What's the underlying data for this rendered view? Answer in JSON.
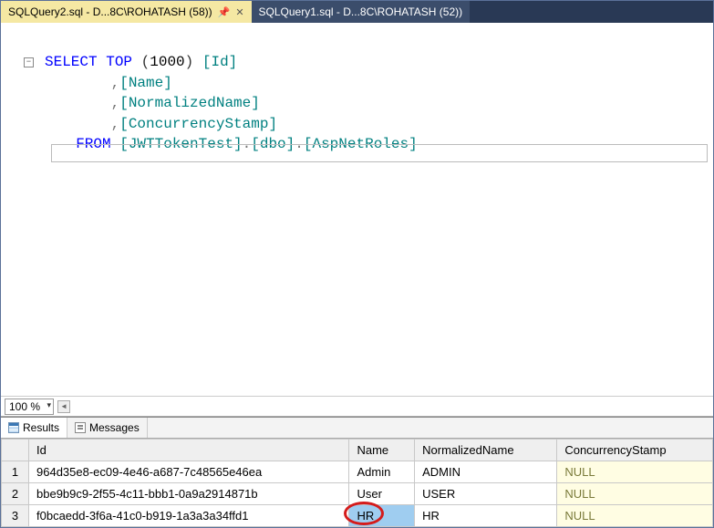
{
  "tabs": [
    {
      "label": "SQLQuery2.sql - D...8C\\ROHATASH (58))",
      "active": true,
      "pinned": true
    },
    {
      "label": "SQLQuery1.sql - D...8C\\ROHATASH (52))",
      "active": false,
      "pinned": false
    }
  ],
  "editor": {
    "fold_glyph": "−",
    "lines": {
      "l1_pre": "",
      "kw_select": "SELECT",
      "sp1": " ",
      "kw_top": "TOP",
      "sp2": " ",
      "paren_open": "(",
      "num_top": "1000",
      "paren_close": ")",
      "sp3": " ",
      "col_id": "[Id]",
      "comma": ",",
      "indent": "      ",
      "col_name": "[Name]",
      "col_norm": "[NormalizedName]",
      "col_stamp": "[ConcurrencyStamp]",
      "kw_from": "FROM",
      "sp4": " ",
      "db": "[JWTTokenTest]",
      "dot": ".",
      "schema": "[dbo]",
      "table": "[AspNetRoles]"
    }
  },
  "zoom": {
    "value": "100 %"
  },
  "result_tabs": {
    "results_label": "Results",
    "messages_label": "Messages"
  },
  "results": {
    "columns": [
      "Id",
      "Name",
      "NormalizedName",
      "ConcurrencyStamp"
    ],
    "rows": [
      {
        "n": "1",
        "Id": "964d35e8-ec09-4e46-a687-7c48565e46ea",
        "Name": "Admin",
        "NormalizedName": "ADMIN",
        "ConcurrencyStamp": "NULL"
      },
      {
        "n": "2",
        "Id": "bbe9b9c9-2f55-4c11-bbb1-0a9a2914871b",
        "Name": "User",
        "NormalizedName": "USER",
        "ConcurrencyStamp": "NULL"
      },
      {
        "n": "3",
        "Id": "f0bcaedd-3f6a-41c0-b919-1a3a3a34ffd1",
        "Name": "HR",
        "NormalizedName": "HR",
        "ConcurrencyStamp": "NULL"
      }
    ],
    "null_literal": "NULL",
    "selected": {
      "row": 2,
      "col": "Name"
    }
  }
}
